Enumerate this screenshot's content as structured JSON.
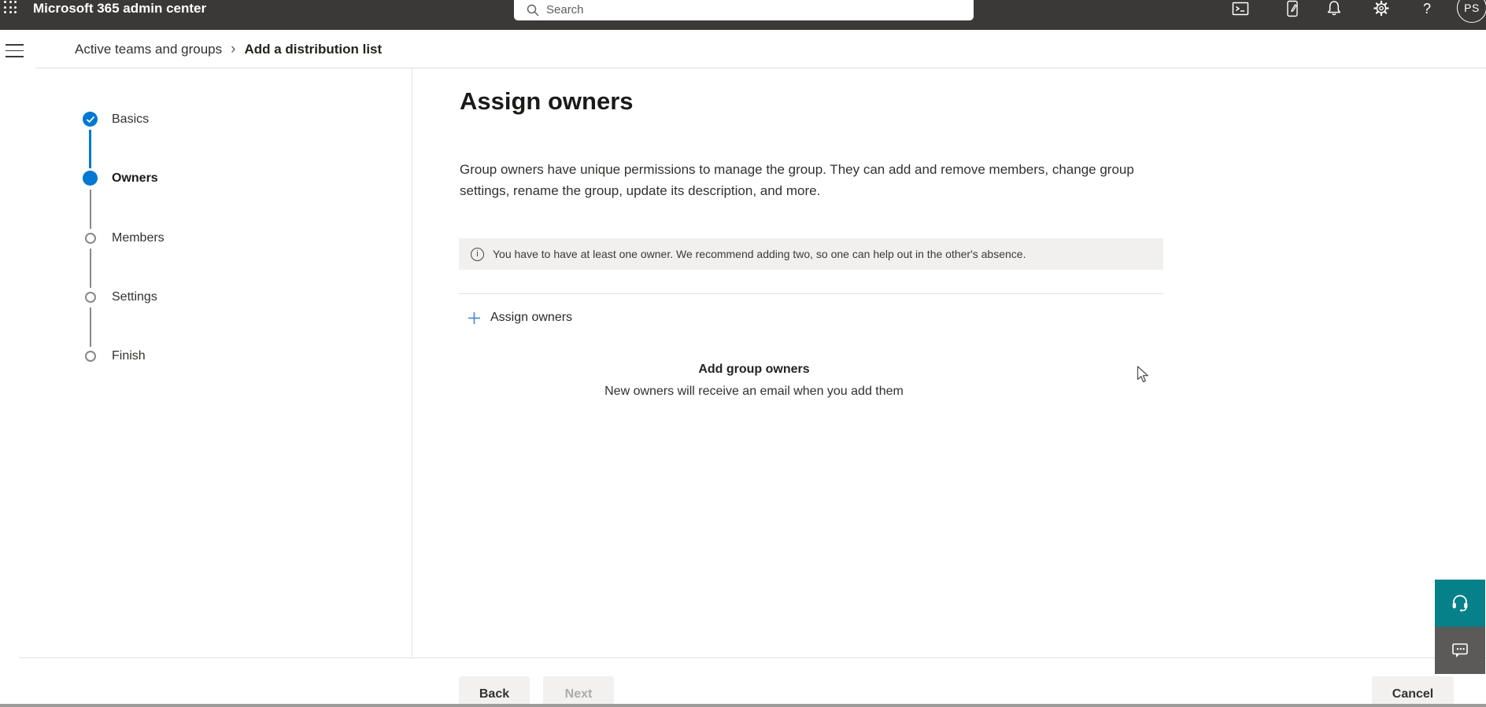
{
  "topbar": {
    "title": "Microsoft 365 admin center",
    "search": {
      "placeholder": "Search",
      "value": ""
    },
    "icons": [
      "app-launcher",
      "terminal",
      "whats-new",
      "notifications",
      "settings",
      "help"
    ],
    "avatar_initials": "PS"
  },
  "breadcrumb": {
    "parent": "Active teams and groups",
    "separator": "›",
    "current": "Add a distribution list"
  },
  "wizard": {
    "steps": [
      {
        "label": "Basics",
        "state": "completed"
      },
      {
        "label": "Owners",
        "state": "current"
      },
      {
        "label": "Members",
        "state": "upcoming"
      },
      {
        "label": "Settings",
        "state": "upcoming"
      },
      {
        "label": "Finish",
        "state": "upcoming"
      }
    ]
  },
  "main": {
    "title": "Assign owners",
    "description": "Group owners have unique permissions to manage the group. They can add and remove members, change group settings, rename the group, update its description, and more.",
    "info_banner": "You have to have at least one owner. We recommend adding two, so one can help out in the other's absence.",
    "assign_owners_link": "Assign owners",
    "empty_state": {
      "title": "Add group owners",
      "subtitle": "New owners will receive an email when you add them"
    }
  },
  "footer": {
    "back_label": "Back",
    "next_label": "Next",
    "next_disabled": true,
    "cancel_label": "Cancel"
  },
  "floating_buttons": [
    "support-headset",
    "feedback"
  ],
  "colors": {
    "accent_blue": "#0078d4",
    "topbar_bg": "#3a3937",
    "support_teal": "#068089",
    "feedback_gray": "#5c5a58",
    "banner_bg": "#f1f0ee",
    "disabled_text": "#aeacaa"
  }
}
